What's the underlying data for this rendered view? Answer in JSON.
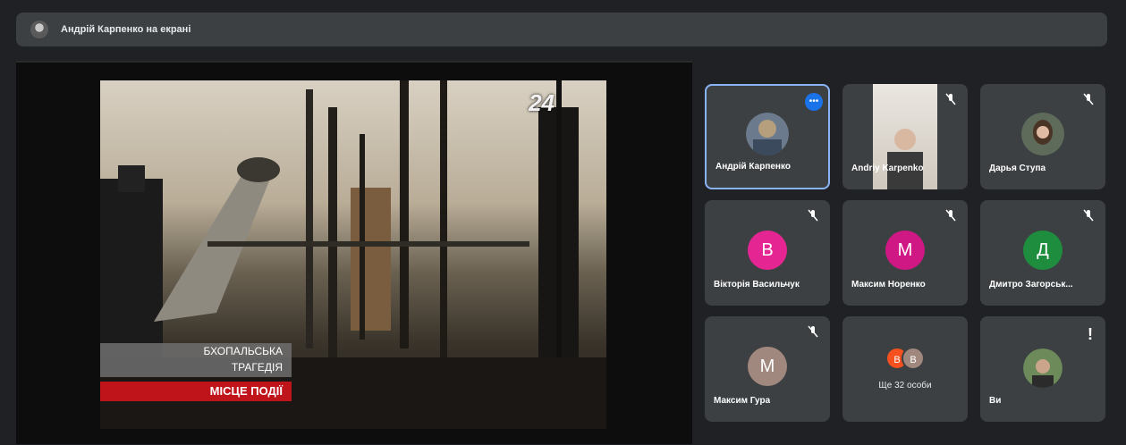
{
  "presenter_bar": {
    "title": "Андрій Карпенко на екрані"
  },
  "video": {
    "channel_logo": "24",
    "caption_lines": [
      "БХОПАЛЬСЬКА",
      "ТРАГЕДІЯ"
    ],
    "caption_red": "МІСЦЕ ПОДІЇ"
  },
  "participants": [
    {
      "name": "Андрій Карпенко",
      "kind": "photo",
      "state": "speaking",
      "active": true
    },
    {
      "name": "Andriy Karpenko",
      "kind": "video",
      "state": "muted"
    },
    {
      "name": "Дарья Ступа",
      "kind": "photo",
      "state": "muted"
    },
    {
      "name": "Вікторія Васильчук",
      "kind": "letter",
      "letter": "В",
      "color": "#e52592",
      "state": "muted"
    },
    {
      "name": "Максим Норенко",
      "kind": "letter",
      "letter": "М",
      "color": "#d01884",
      "state": "muted"
    },
    {
      "name": "Дмитро Загорськ...",
      "kind": "letter",
      "letter": "Д",
      "color": "#1e8e3e",
      "state": "muted"
    },
    {
      "name": "Максим Гура",
      "kind": "letter",
      "letter": "М",
      "color": "#a1887f",
      "state": "muted"
    },
    {
      "name": "Ще 32 особи",
      "kind": "more",
      "mini_letters": [
        "В",
        "В"
      ],
      "mini_colors": [
        "#f4511e",
        "#a1887f"
      ]
    },
    {
      "name": "Ви",
      "kind": "photo",
      "state": "alert"
    }
  ],
  "icons": {
    "muted": "mic-off-icon",
    "speaking": "audio-wave-icon",
    "alert": "exclamation-icon"
  }
}
